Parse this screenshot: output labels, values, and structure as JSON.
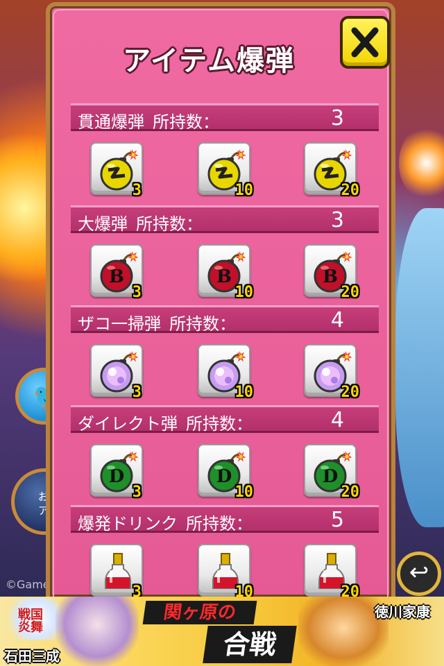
{
  "dialog": {
    "title": "アイテム爆弾",
    "close_label": "✕"
  },
  "sections": [
    {
      "name": "貫通爆弾",
      "count_label": "所持数：",
      "count": "3",
      "icon": "yellow-bomb-icon",
      "quantities": [
        "3",
        "10",
        "20"
      ]
    },
    {
      "name": "大爆弾",
      "count_label": "所持数：",
      "count": "3",
      "icon": "red-b-bomb-icon",
      "quantities": [
        "3",
        "10",
        "20"
      ]
    },
    {
      "name": "ザコ一掃弾",
      "count_label": "所持数：",
      "count": "4",
      "icon": "purple-bomb-icon",
      "quantities": [
        "3",
        "10",
        "20"
      ]
    },
    {
      "name": "ダイレクト弾",
      "count_label": "所持数：",
      "count": "4",
      "icon": "green-d-bomb-icon",
      "quantities": [
        "3",
        "10",
        "20"
      ]
    },
    {
      "name": "爆発ドリンク",
      "count_label": "所持数：",
      "count": "5",
      "icon": "red-drink-bottle-icon",
      "quantities": [
        "3",
        "10",
        "20"
      ]
    }
  ],
  "background": {
    "copyright": "©Game",
    "osusume": "おす\nアプ"
  },
  "ad": {
    "logo": "戦国\n炎舞",
    "title_1": "関ヶ原の",
    "title_2": "合戦",
    "left_name": "石田三成",
    "right_name": "徳川家康"
  },
  "colors": {
    "dialog_bg": "#e95d9a",
    "section_header": "#b9346f",
    "close_button": "#f6df14",
    "quantity_text": "#ffd700"
  }
}
